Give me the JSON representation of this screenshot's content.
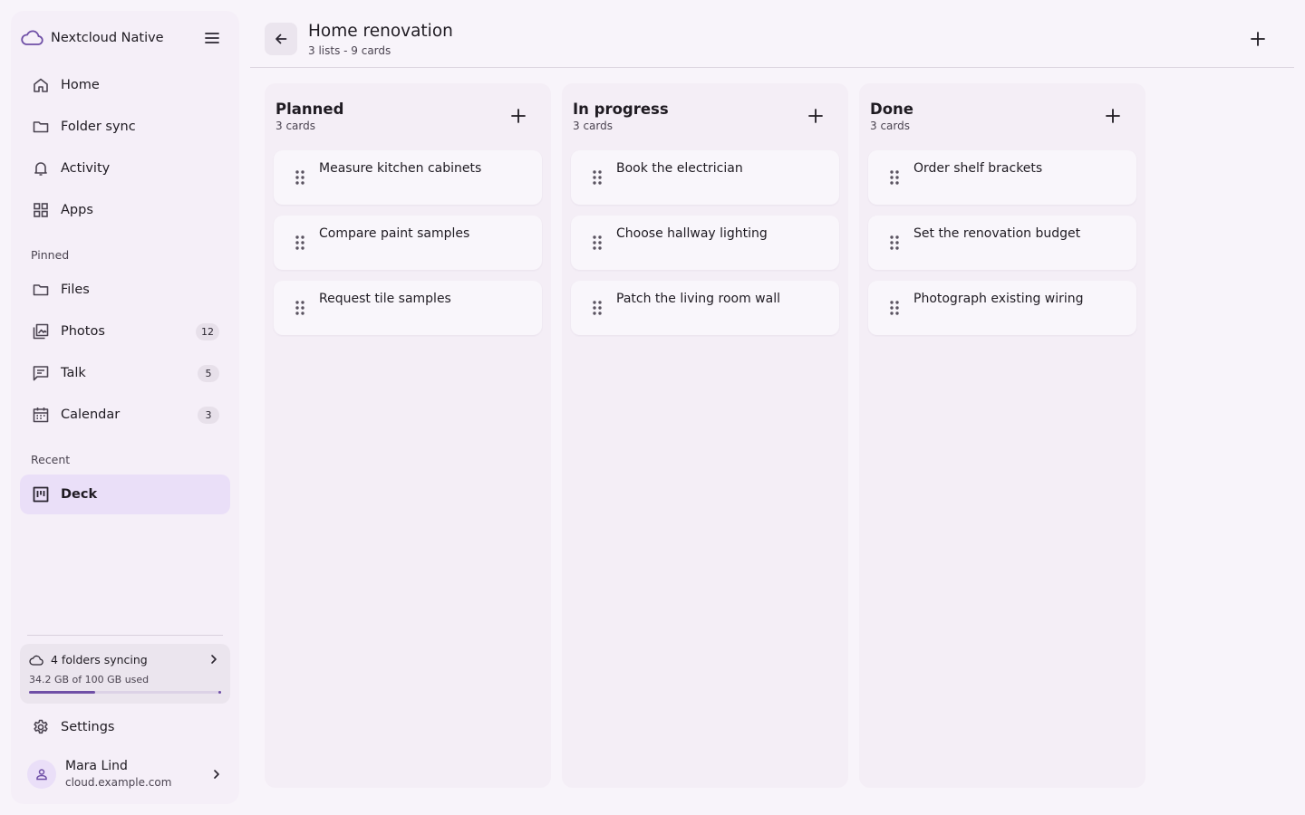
{
  "app": {
    "name": "Nextcloud Native",
    "accent": "#6f4fa6"
  },
  "sidebar": {
    "items": [
      {
        "label": "Home",
        "icon": "home-icon"
      },
      {
        "label": "Folder sync",
        "icon": "folder-icon"
      },
      {
        "label": "Activity",
        "icon": "bell-icon"
      },
      {
        "label": "Apps",
        "icon": "apps-grid-icon"
      }
    ],
    "pinned_label": "Pinned",
    "pinned": [
      {
        "label": "Files",
        "icon": "folder-icon",
        "badge": ""
      },
      {
        "label": "Photos",
        "icon": "photos-icon",
        "badge": "12"
      },
      {
        "label": "Talk",
        "icon": "chat-icon",
        "badge": "5"
      },
      {
        "label": "Calendar",
        "icon": "calendar-icon",
        "badge": "3"
      }
    ],
    "recent_label": "Recent",
    "recent": [
      {
        "label": "Deck",
        "icon": "deck-icon",
        "active": true
      }
    ],
    "sync": {
      "status": "4 folders syncing",
      "usage": "34.2 GB of 100 GB used",
      "used_fraction": 0.342
    },
    "settings_label": "Settings",
    "account": {
      "name": "Mara Lind",
      "host": "cloud.example.com"
    }
  },
  "header": {
    "title": "Home renovation",
    "subtitle": "3 lists - 9 cards"
  },
  "board": {
    "lists": [
      {
        "title": "Planned",
        "count": "3 cards",
        "cards": [
          "Measure kitchen cabinets",
          "Compare paint samples",
          "Request tile samples"
        ]
      },
      {
        "title": "In progress",
        "count": "3 cards",
        "cards": [
          "Book the electrician",
          "Choose hallway lighting",
          "Patch the living room wall"
        ]
      },
      {
        "title": "Done",
        "count": "3 cards",
        "cards": [
          "Order shelf brackets",
          "Set the renovation budget",
          "Photograph existing wiring"
        ]
      }
    ]
  }
}
